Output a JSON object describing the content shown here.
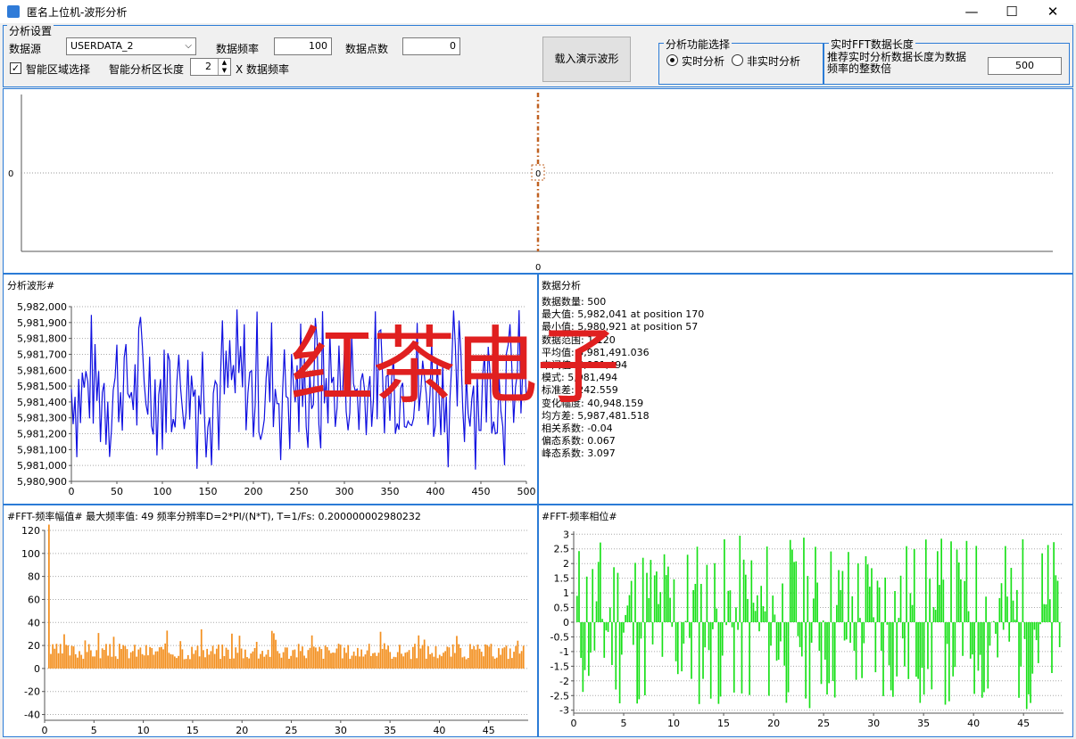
{
  "window": {
    "title": "匿名上位机-波形分析",
    "minimize": "—",
    "maximize": "☐",
    "close": "✕"
  },
  "settings": {
    "group_label": "分析设置",
    "source_label": "数据源",
    "source_value": "USERDATA_2",
    "freq_label": "数据频率",
    "freq_value": "100",
    "points_label": "数据点数",
    "points_value": "0",
    "smart_label": "智能区域选择",
    "smart_len_label": "智能分析区长度",
    "smart_len_value": "2",
    "smart_len_unit": "X 数据频率",
    "load_button": "载入演示波形",
    "func_group": "分析功能选择",
    "realtime": "实时分析",
    "nonrealtime": "非实时分析",
    "fft_group": "实时FFT数据长度",
    "fft_hint_line1": "推荐实时分析数据长度为数据",
    "fft_hint_line2": "频率的整数倍",
    "fft_len_value": "500"
  },
  "top_chart": {
    "y_label": "0",
    "x_label": "0",
    "marker_label": "0"
  },
  "wave_panel": {
    "title": "分析波形#"
  },
  "analysis_panel": {
    "title": "数据分析",
    "lines": [
      "数据数量: 500",
      "最大值: 5,982,041 at position 170",
      "最小值: 5,980,921 at position 57",
      "数据范围: 1,120",
      "平均值: 5,981,491.036",
      "中间值: 5,981,494",
      "模式: 5,981,494",
      "标准差: 242.559",
      "变化幅度: 40,948.159",
      "均方差: 5,987,481.518",
      "相关系数: -0.04",
      "偏态系数: 0.067",
      "峰态系数: 3.097"
    ]
  },
  "fft_amp_panel": {
    "title": "#FFT-频率幅值#  最大频率值:    49  频率分辨率D=2*PI/(N*T), T=1/Fs:    0.200000002980232"
  },
  "fft_phase_panel": {
    "title": "#FFT-频率相位#"
  },
  "watermark": "红茶电子",
  "chart_data": [
    {
      "type": "line",
      "name": "wave",
      "x_range": [
        0,
        500
      ],
      "ylim": [
        5980900,
        5982000
      ],
      "yticks": [
        "5,982,000",
        "5,981,900",
        "5,981,800",
        "5,981,700",
        "5,981,600",
        "5,981,500",
        "5,981,400",
        "5,981,300",
        "5,981,200",
        "5,981,100",
        "5,981,000",
        "5,980,900"
      ],
      "xticks": [
        "0",
        "50",
        "100",
        "150",
        "200",
        "250",
        "300",
        "350",
        "400",
        "450",
        "500"
      ],
      "color": "#1010e0"
    },
    {
      "type": "bar",
      "name": "fft-amplitude",
      "x_range": [
        0,
        49
      ],
      "ylim": [
        -45,
        120
      ],
      "yticks": [
        "120",
        "100",
        "80",
        "60",
        "40",
        "20",
        "0",
        "-20",
        "-40"
      ],
      "xticks": [
        "0",
        "5",
        "10",
        "15",
        "20",
        "25",
        "30",
        "35",
        "40",
        "45"
      ],
      "color": "#f39020",
      "peak": {
        "x": 0,
        "value": 125
      }
    },
    {
      "type": "bar",
      "name": "fft-phase",
      "x_range": [
        0,
        49
      ],
      "ylim": [
        -3.1,
        3.1
      ],
      "yticks": [
        "3",
        "2.5",
        "2",
        "1.5",
        "1",
        "0.5",
        "0",
        "-0.5",
        "-1",
        "-1.5",
        "-2",
        "-2.5",
        "-3"
      ],
      "xticks": [
        "0",
        "5",
        "10",
        "15",
        "20",
        "25",
        "30",
        "35",
        "40",
        "45"
      ],
      "color": "#18e018"
    }
  ]
}
